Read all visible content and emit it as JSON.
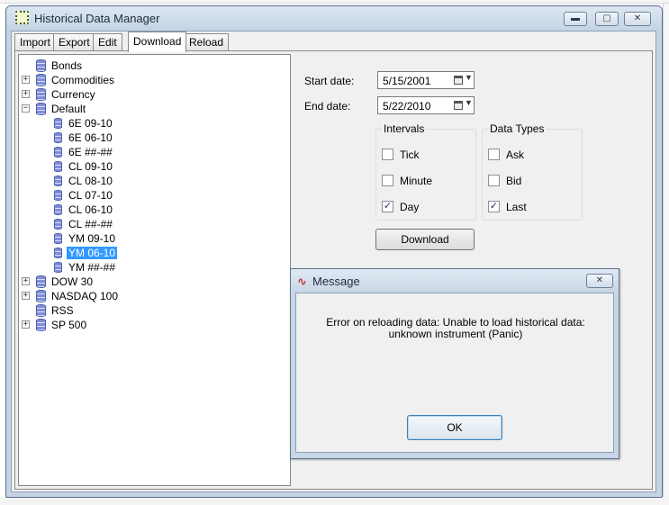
{
  "window": {
    "title": "Historical Data Manager",
    "min_glyph": "▬",
    "max_glyph": "▢",
    "close_glyph": "✕"
  },
  "tabs": [
    {
      "label": "Import",
      "active": false
    },
    {
      "label": "Export",
      "active": false
    },
    {
      "label": "Edit",
      "active": false
    },
    {
      "label": "Download",
      "active": true
    },
    {
      "label": "Reload",
      "active": false
    }
  ],
  "tree": {
    "expand_glyph": "+",
    "collapse_glyph": "−",
    "items": [
      {
        "label": "Bonds"
      },
      {
        "label": "Commodities",
        "expandable": true
      },
      {
        "label": "Currency",
        "expandable": true
      },
      {
        "label": "Default",
        "expanded": true
      },
      {
        "label": "6E 09-10"
      },
      {
        "label": "6E 06-10"
      },
      {
        "label": "6E ##-##"
      },
      {
        "label": "CL 09-10"
      },
      {
        "label": "CL 08-10"
      },
      {
        "label": "CL 07-10"
      },
      {
        "label": "CL 06-10"
      },
      {
        "label": "CL ##-##"
      },
      {
        "label": "YM 09-10"
      },
      {
        "label": "YM 06-10",
        "selected": true
      },
      {
        "label": "YM ##-##"
      },
      {
        "label": "DOW 30",
        "expandable": true
      },
      {
        "label": "NASDAQ 100",
        "expandable": true
      },
      {
        "label": "RSS"
      },
      {
        "label": "SP 500",
        "expandable": true
      }
    ]
  },
  "form": {
    "start_label": "Start date:",
    "start_value": "5/15/2001",
    "end_label": "End date:",
    "end_value": "5/22/2010",
    "dropdown_glyph": "▼",
    "intervals": {
      "title": "Intervals",
      "items": [
        {
          "label": "Tick",
          "checked": false
        },
        {
          "label": "Minute",
          "checked": false
        },
        {
          "label": "Day",
          "checked": true
        }
      ]
    },
    "data_types": {
      "title": "Data Types",
      "items": [
        {
          "label": "Ask",
          "checked": false
        },
        {
          "label": "Bid",
          "checked": false
        },
        {
          "label": "Last",
          "checked": true
        }
      ]
    },
    "check_glyph": "✓",
    "download_label": "Download"
  },
  "dialog": {
    "title": "Message",
    "icon_glyph": "∿",
    "close_glyph": "✕",
    "message": "Error on reloading data: Unable to load historical data: unknown instrument (Panic)",
    "ok_label": "OK"
  }
}
